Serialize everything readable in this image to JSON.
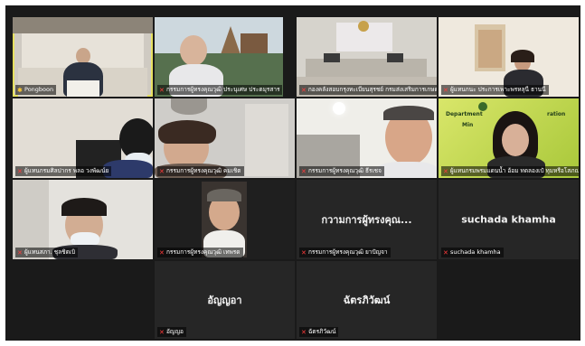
{
  "tiles": [
    {
      "caption": "Pongboon",
      "icon": "pin-icon"
    },
    {
      "caption": "กรรมการผู้ทรงคุณวุฒิ ประนุเศษ ประตมุรสาร",
      "icon": "mic-off-icon"
    },
    {
      "caption": "กองคลังสอบกรุงทะเบียนสุรชย์ กรมส่งเสริมการเกษตร",
      "icon": "mic-off-icon"
    },
    {
      "caption": "ผู้แทนกนะ ประการเพาะพรหลุนี ธานนี",
      "icon": "mic-off-icon"
    },
    {
      "caption": "ผู้แทนกรมศิลปากร พลอ วงพัฒน์ย",
      "icon": "mic-off-icon"
    },
    {
      "caption": "กรรมการผู้ทรงคุณวุฒิ คมเชิต",
      "icon": "mic-off-icon"
    },
    {
      "caption": "กรรมการผู้ทรงคุณวุฒิ ธีรเชจ",
      "icon": "mic-off-icon"
    },
    {
      "caption": "ผู้แทนกรมพรมแดนน้ำ อ้อม ทดลองเป๋ ทุมหรือโสภณ",
      "icon": "mic-off-icon"
    },
    {
      "caption": "ผู้แทนสภา. ชุลชิตเบิ",
      "icon": "mic-off-icon"
    },
    {
      "caption": "กรรมการผู้ทรงคุณวุฒิ เทพรด",
      "icon": "mic-off-icon"
    },
    {
      "caption": "กรรมการผู้ทรงคุณวุฒิ ยาปัญจา",
      "icon": "mic-off-icon",
      "display_name": "กวามการผู้ทรงคุณ..."
    },
    {
      "caption": "suchada khamha",
      "icon": "mic-off-icon",
      "display_name": "suchada khamha"
    },
    {
      "caption": "อัญญอ",
      "icon": "mic-off-icon",
      "display_name": "อัญญอา"
    },
    {
      "caption": "ฉัตรภิวัฒน์",
      "icon": "mic-off-icon",
      "display_name": "ฉัตรภิวัฒน์"
    }
  ],
  "slide_text": {
    "line1": "Department",
    "line2": "ration",
    "line3": "Min"
  },
  "colors": {
    "speaker_border": "#e6e060",
    "mic_off": "#ff3b3b",
    "tile_bg": "#262626"
  }
}
